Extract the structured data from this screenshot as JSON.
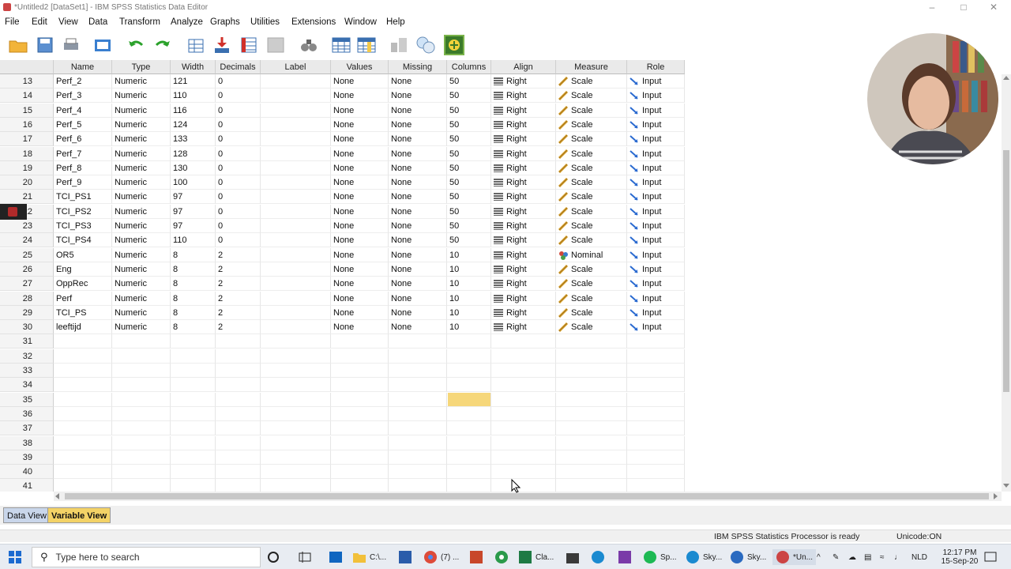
{
  "window": {
    "title": "*Untitled2 [DataSet1] - IBM SPSS Statistics Data Editor"
  },
  "menu": [
    "File",
    "Edit",
    "View",
    "Data",
    "Transform",
    "Analyze",
    "Graphs",
    "Utilities",
    "Extensions",
    "Window",
    "Help"
  ],
  "columns": [
    "Name",
    "Type",
    "Width",
    "Decimals",
    "Label",
    "Values",
    "Missing",
    "Columns",
    "Align",
    "Measure",
    "Role"
  ],
  "rows": [
    {
      "n": "13",
      "name": "Perf_2",
      "type": "Numeric",
      "width": "121",
      "dec": "0",
      "label": "",
      "values": "None",
      "missing": "None",
      "cols": "50",
      "align": "Right",
      "measure": "Scale",
      "role": "Input"
    },
    {
      "n": "14",
      "name": "Perf_3",
      "type": "Numeric",
      "width": "110",
      "dec": "0",
      "label": "",
      "values": "None",
      "missing": "None",
      "cols": "50",
      "align": "Right",
      "measure": "Scale",
      "role": "Input"
    },
    {
      "n": "15",
      "name": "Perf_4",
      "type": "Numeric",
      "width": "116",
      "dec": "0",
      "label": "",
      "values": "None",
      "missing": "None",
      "cols": "50",
      "align": "Right",
      "measure": "Scale",
      "role": "Input"
    },
    {
      "n": "16",
      "name": "Perf_5",
      "type": "Numeric",
      "width": "124",
      "dec": "0",
      "label": "",
      "values": "None",
      "missing": "None",
      "cols": "50",
      "align": "Right",
      "measure": "Scale",
      "role": "Input"
    },
    {
      "n": "17",
      "name": "Perf_6",
      "type": "Numeric",
      "width": "133",
      "dec": "0",
      "label": "",
      "values": "None",
      "missing": "None",
      "cols": "50",
      "align": "Right",
      "measure": "Scale",
      "role": "Input"
    },
    {
      "n": "18",
      "name": "Perf_7",
      "type": "Numeric",
      "width": "128",
      "dec": "0",
      "label": "",
      "values": "None",
      "missing": "None",
      "cols": "50",
      "align": "Right",
      "measure": "Scale",
      "role": "Input"
    },
    {
      "n": "19",
      "name": "Perf_8",
      "type": "Numeric",
      "width": "130",
      "dec": "0",
      "label": "",
      "values": "None",
      "missing": "None",
      "cols": "50",
      "align": "Right",
      "measure": "Scale",
      "role": "Input"
    },
    {
      "n": "20",
      "name": "Perf_9",
      "type": "Numeric",
      "width": "100",
      "dec": "0",
      "label": "",
      "values": "None",
      "missing": "None",
      "cols": "50",
      "align": "Right",
      "measure": "Scale",
      "role": "Input"
    },
    {
      "n": "21",
      "name": "TCI_PS1",
      "type": "Numeric",
      "width": "97",
      "dec": "0",
      "label": "",
      "values": "None",
      "missing": "None",
      "cols": "50",
      "align": "Right",
      "measure": "Scale",
      "role": "Input"
    },
    {
      "n": "22",
      "name": "TCI_PS2",
      "type": "Numeric",
      "width": "97",
      "dec": "0",
      "label": "",
      "values": "None",
      "missing": "None",
      "cols": "50",
      "align": "Right",
      "measure": "Scale",
      "role": "Input"
    },
    {
      "n": "23",
      "name": "TCI_PS3",
      "type": "Numeric",
      "width": "97",
      "dec": "0",
      "label": "",
      "values": "None",
      "missing": "None",
      "cols": "50",
      "align": "Right",
      "measure": "Scale",
      "role": "Input"
    },
    {
      "n": "24",
      "name": "TCI_PS4",
      "type": "Numeric",
      "width": "110",
      "dec": "0",
      "label": "",
      "values": "None",
      "missing": "None",
      "cols": "50",
      "align": "Right",
      "measure": "Scale",
      "role": "Input"
    },
    {
      "n": "25",
      "name": "OR5",
      "type": "Numeric",
      "width": "8",
      "dec": "2",
      "label": "",
      "values": "None",
      "missing": "None",
      "cols": "10",
      "align": "Right",
      "measure": "Nominal",
      "role": "Input"
    },
    {
      "n": "26",
      "name": "Eng",
      "type": "Numeric",
      "width": "8",
      "dec": "2",
      "label": "",
      "values": "None",
      "missing": "None",
      "cols": "10",
      "align": "Right",
      "measure": "Scale",
      "role": "Input"
    },
    {
      "n": "27",
      "name": "OppRec",
      "type": "Numeric",
      "width": "8",
      "dec": "2",
      "label": "",
      "values": "None",
      "missing": "None",
      "cols": "10",
      "align": "Right",
      "measure": "Scale",
      "role": "Input"
    },
    {
      "n": "28",
      "name": "Perf",
      "type": "Numeric",
      "width": "8",
      "dec": "2",
      "label": "",
      "values": "None",
      "missing": "None",
      "cols": "10",
      "align": "Right",
      "measure": "Scale",
      "role": "Input"
    },
    {
      "n": "29",
      "name": "TCI_PS",
      "type": "Numeric",
      "width": "8",
      "dec": "2",
      "label": "",
      "values": "None",
      "missing": "None",
      "cols": "10",
      "align": "Right",
      "measure": "Scale",
      "role": "Input"
    },
    {
      "n": "30",
      "name": "leeftijd",
      "type": "Numeric",
      "width": "8",
      "dec": "2",
      "label": "",
      "values": "None",
      "missing": "None",
      "cols": "10",
      "align": "Right",
      "measure": "Scale",
      "role": "Input"
    }
  ],
  "empty_rows": [
    "31",
    "32",
    "33",
    "34",
    "35",
    "36",
    "37",
    "38",
    "39",
    "40",
    "41"
  ],
  "tabs": {
    "data_view": "Data View",
    "variable_view": "Variable View"
  },
  "status": {
    "processor": "IBM SPSS Statistics Processor is ready",
    "unicode": "Unicode:ON"
  },
  "taskbar": {
    "search_placeholder": "Type here to search",
    "items": [
      "C:\\...",
      "(7) ...",
      "Cla...",
      "Sp...",
      "Sky...",
      "Sky...",
      "*Un..."
    ],
    "lang": "NLD",
    "time": "12:17 PM",
    "date": "15-Sep-20"
  },
  "colors": {
    "selected_cell": "#f6d77a",
    "variable_view_tab": "#f3d266",
    "data_view_tab": "#c9d6ea"
  }
}
